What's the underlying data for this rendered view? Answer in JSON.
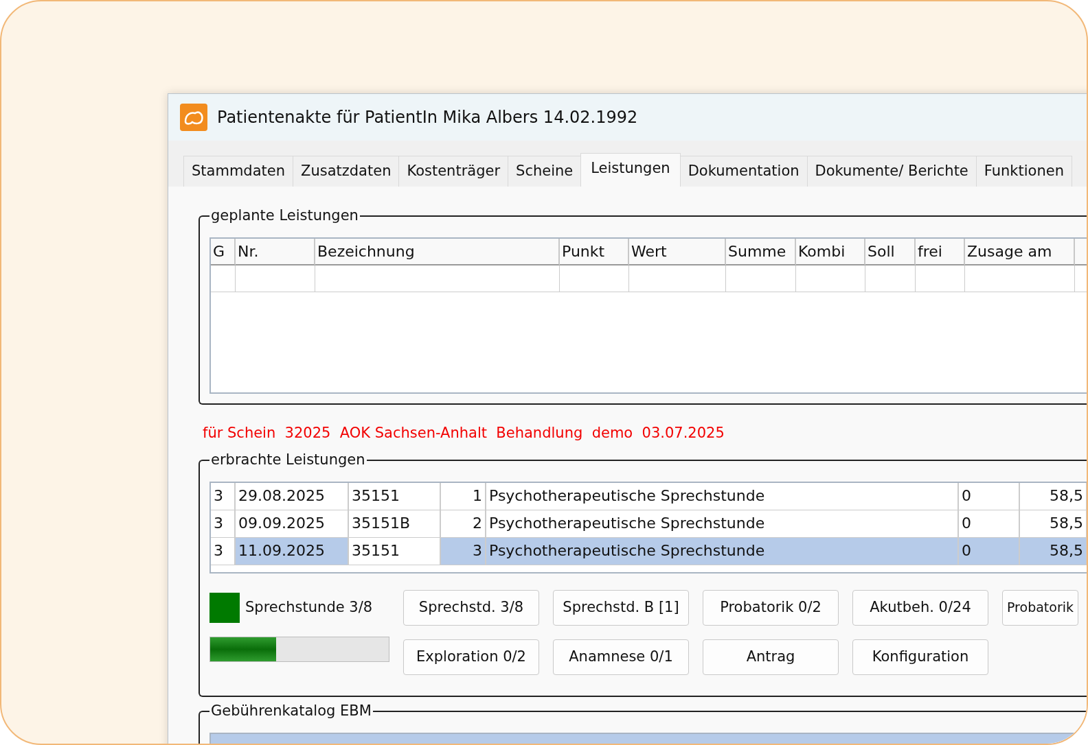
{
  "window": {
    "title": "Patientenakte für PatientIn Mika Albers 14.02.1992"
  },
  "tabs": [
    {
      "label": "Stammdaten",
      "selected": false
    },
    {
      "label": "Zusatzdaten",
      "selected": false
    },
    {
      "label": "Kostenträger",
      "selected": false
    },
    {
      "label": "Scheine",
      "selected": false
    },
    {
      "label": "Leistungen",
      "selected": true
    },
    {
      "label": "Dokumentation",
      "selected": false
    },
    {
      "label": "Dokumente/ Berichte",
      "selected": false
    },
    {
      "label": "Funktionen",
      "selected": false
    }
  ],
  "planned": {
    "legend": "geplante Leistungen",
    "columns": [
      "G",
      "Nr.",
      "Bezeichnung",
      "Punkt",
      "Wert",
      "Summe",
      "Kombi",
      "Soll",
      "frei",
      "Zusage am"
    ]
  },
  "schein_info": "für Schein  32025  AOK Sachsen-Anhalt  Behandlung  demo  03.07.2025",
  "performed": {
    "legend": "erbrachte Leistungen",
    "rows": [
      {
        "group": "3",
        "date": "29.08.2025",
        "code": "35151",
        "count": "1",
        "name": "Psychotherapeutische Sprechstunde",
        "column_6": "0",
        "value": "58,5",
        "selected": false
      },
      {
        "group": "3",
        "date": "09.09.2025",
        "code": "35151B",
        "count": "2",
        "name": "Psychotherapeutische Sprechstunde",
        "column_6": "0",
        "value": "58,5",
        "selected": false
      },
      {
        "group": "3",
        "date": "11.09.2025",
        "code": "35151",
        "count": "3",
        "name": "Psychotherapeutische Sprechstunde",
        "column_6": "0",
        "value": "58,5",
        "selected": true
      }
    ]
  },
  "status": {
    "label": "Sprechstunde 3/8",
    "color": "#007a00",
    "level": 0.37
  },
  "buttons": [
    [
      "Sprechstd. 3/8",
      "Sprechstd. B [1]",
      "Probatorik 0/2",
      "Akutbeh. 0/24",
      "Probatorik"
    ],
    [
      "Exploration 0/2",
      "Anamnese 0/1",
      "Antrag",
      "Konfiguration"
    ]
  ],
  "catalog": {
    "legend": "Gebührenkatalog EBM"
  }
}
